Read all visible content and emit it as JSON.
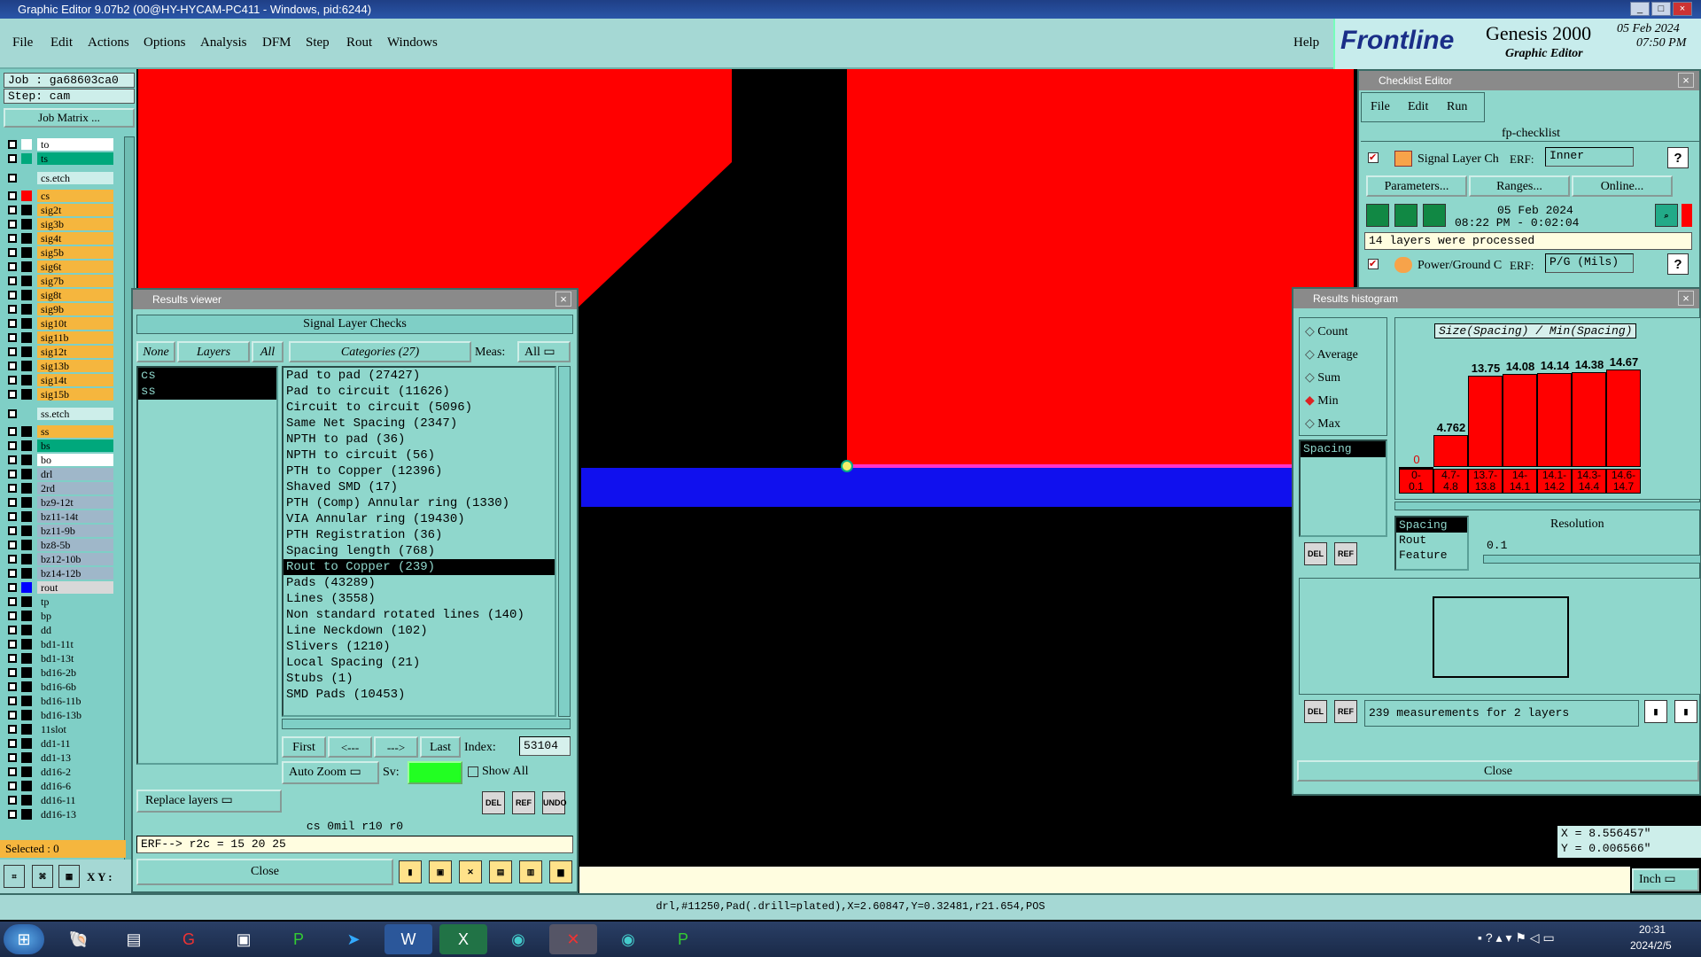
{
  "window": {
    "title": "Graphic Editor 9.07b2 (00@HY-HYCAM-PC411 - Windows, pid:6244)"
  },
  "menu": {
    "items": [
      "File",
      "Edit",
      "Actions",
      "Options",
      "Analysis",
      "DFM",
      "Step",
      "Rout",
      "Windows"
    ],
    "help": "Help"
  },
  "logo": {
    "brand": "Frontline",
    "product": "Genesis 2000",
    "subtitle": "Graphic Editor",
    "date": "05 Feb 2024",
    "time": "07:50 PM"
  },
  "job": {
    "job": "Job : ga68603ca0",
    "step": "Step: cam",
    "matrix_button": "Job Matrix ..."
  },
  "layers": [
    {
      "name": "to",
      "color": "#ffffff",
      "fill": "#ffffff"
    },
    {
      "name": "ts",
      "color": "#00a87c",
      "fill": "#00a87c"
    },
    {
      "name": "cs.etch",
      "color": "#7fcfc6",
      "fill": "#cdeeea",
      "header": true
    },
    {
      "name": "cs",
      "color": "#ff0000",
      "fill": "#f5b63e"
    },
    {
      "name": "sig2t",
      "color": "#000",
      "fill": "#f5b63e"
    },
    {
      "name": "sig3b",
      "color": "#000",
      "fill": "#f5b63e"
    },
    {
      "name": "sig4t",
      "color": "#000",
      "fill": "#f5b63e"
    },
    {
      "name": "sig5b",
      "color": "#000",
      "fill": "#f5b63e"
    },
    {
      "name": "sig6t",
      "color": "#000",
      "fill": "#f5b63e"
    },
    {
      "name": "sig7b",
      "color": "#000",
      "fill": "#f5b63e"
    },
    {
      "name": "sig8t",
      "color": "#000",
      "fill": "#f5b63e"
    },
    {
      "name": "sig9b",
      "color": "#000",
      "fill": "#f5b63e"
    },
    {
      "name": "sig10t",
      "color": "#000",
      "fill": "#f5b63e"
    },
    {
      "name": "sig11b",
      "color": "#000",
      "fill": "#f5b63e"
    },
    {
      "name": "sig12t",
      "color": "#000",
      "fill": "#f5b63e"
    },
    {
      "name": "sig13b",
      "color": "#000",
      "fill": "#f5b63e"
    },
    {
      "name": "sig14t",
      "color": "#000",
      "fill": "#f5b63e"
    },
    {
      "name": "sig15b",
      "color": "#000",
      "fill": "#f5b63e"
    },
    {
      "name": "ss.etch",
      "color": "#7fcfc6",
      "fill": "#cdeeea",
      "header": true
    },
    {
      "name": "ss",
      "color": "#000",
      "fill": "#f5b63e"
    },
    {
      "name": "bs",
      "color": "#000",
      "fill": "#00a87c"
    },
    {
      "name": "bo",
      "color": "#000",
      "fill": "#ffffff"
    },
    {
      "name": "drl",
      "color": "#000",
      "fill": "#9fb7c9"
    },
    {
      "name": "2rd",
      "color": "#000",
      "fill": "#9fb7c9"
    },
    {
      "name": "bz9-12t",
      "color": "#000",
      "fill": "#9fb7c9"
    },
    {
      "name": "bz11-14t",
      "color": "#000",
      "fill": "#9fb7c9"
    },
    {
      "name": "bz11-9b",
      "color": "#000",
      "fill": "#9fb7c9"
    },
    {
      "name": "bz8-5b",
      "color": "#000",
      "fill": "#9fb7c9"
    },
    {
      "name": "bz12-10b",
      "color": "#000",
      "fill": "#9fb7c9"
    },
    {
      "name": "bz14-12b",
      "color": "#000",
      "fill": "#9fb7c9"
    },
    {
      "name": "rout",
      "color": "#0000ff",
      "fill": "#d8d8d8"
    },
    {
      "name": "tp",
      "color": "#000",
      "fill": "#7fcfc6"
    },
    {
      "name": "bp",
      "color": "#000",
      "fill": "#7fcfc6"
    },
    {
      "name": "dd",
      "color": "#000",
      "fill": "#7fcfc6"
    },
    {
      "name": "bd1-11t",
      "color": "#000",
      "fill": "#7fcfc6"
    },
    {
      "name": "bd1-13t",
      "color": "#000",
      "fill": "#7fcfc6"
    },
    {
      "name": "bd16-2b",
      "color": "#000",
      "fill": "#7fcfc6"
    },
    {
      "name": "bd16-6b",
      "color": "#000",
      "fill": "#7fcfc6"
    },
    {
      "name": "bd16-11b",
      "color": "#000",
      "fill": "#7fcfc6"
    },
    {
      "name": "bd16-13b",
      "color": "#000",
      "fill": "#7fcfc6"
    },
    {
      "name": "11slot",
      "color": "#000",
      "fill": "#7fcfc6"
    },
    {
      "name": "dd1-11",
      "color": "#000",
      "fill": "#7fcfc6"
    },
    {
      "name": "dd1-13",
      "color": "#000",
      "fill": "#7fcfc6"
    },
    {
      "name": "dd16-2",
      "color": "#000",
      "fill": "#7fcfc6"
    },
    {
      "name": "dd16-6",
      "color": "#000",
      "fill": "#7fcfc6"
    },
    {
      "name": "dd16-11",
      "color": "#000",
      "fill": "#7fcfc6"
    },
    {
      "name": "dd16-13",
      "color": "#000",
      "fill": "#7fcfc6"
    }
  ],
  "selected": "Selected : 0",
  "xy_label": "X Y :",
  "results_viewer": {
    "title": "Results viewer",
    "header": "Signal Layer Checks",
    "none": "None",
    "layers": "Layers",
    "all": "All",
    "categories_btn": "Categories (27)",
    "meas": "Meas:",
    "meas_value": "All",
    "layer_list": [
      "cs",
      "ss"
    ],
    "categories": [
      "Pad to pad (27427)",
      "Pad to circuit (11626)",
      "Circuit to circuit (5096)",
      "Same Net Spacing (2347)",
      "NPTH to pad (36)",
      "NPTH to circuit (56)",
      "PTH to Copper (12396)",
      "Shaved SMD (17)",
      "PTH (Comp) Annular ring (1330)",
      "VIA Annular ring (19430)",
      "PTH Registration (36)",
      "Spacing length (768)",
      "Rout to Copper (239)",
      "Pads (43289)",
      "Lines (3558)",
      "Non standard rotated lines (140)",
      "Line Neckdown (102)",
      "Slivers (1210)",
      "Local Spacing (21)",
      "Stubs (1)",
      "SMD Pads (10453)"
    ],
    "selected_index": 12,
    "first": "First",
    "prev": "<---",
    "next": "--->",
    "last": "Last",
    "index_label": "Index:",
    "index_value": "53104",
    "auto_zoom": "Auto Zoom",
    "sv": "Sv:",
    "show_all": "Show All",
    "replace_layers": "Replace layers",
    "info_line": "cs 0mil   r10   r0",
    "erf_line": "ERF--> r2c = 15 20 25",
    "close": "Close"
  },
  "checklist": {
    "title": "Checklist Editor",
    "menu": [
      "File",
      "Edit",
      "Run"
    ],
    "name": "fp-checklist",
    "check1_name": "Signal Layer Ch",
    "erf_label": "ERF:",
    "check1_erf": "Inner",
    "params": "Parameters...",
    "ranges": "Ranges...",
    "online": "Online...",
    "date": "05 Feb 2024",
    "time": "08:22 PM - 0:02:04",
    "processed": "14 layers were processed",
    "check2_name": "Power/Ground C",
    "check2_erf": "P/G (Mils)"
  },
  "histogram": {
    "title": "Results histogram",
    "options": [
      "Count",
      "Average",
      "Sum",
      "Min",
      "Max"
    ],
    "selected_option": "Min",
    "measure": "Spacing",
    "chart_title": "Size(Spacing) / Min(Spacing)",
    "bars": [
      {
        "range": "0-0.1",
        "value": 0
      },
      {
        "range": "4.7-4.8",
        "value": 4.762
      },
      {
        "range": "13.7-13.8",
        "value": 13.75
      },
      {
        "range": "14-14.1",
        "value": 14.08
      },
      {
        "range": "14.1-14.2",
        "value": 14.14
      },
      {
        "range": "14.3-14.4",
        "value": 14.38
      },
      {
        "range": "14.6-14.7",
        "value": 14.67
      }
    ],
    "bar_labels": [
      "0",
      "4.762",
      "13.75",
      "14.08",
      "14.14",
      "14.38",
      "14.67"
    ],
    "range_labels": [
      "0-\n0.1",
      "4.7-\n4.8",
      "13.7-\n13.8",
      "14-\n14.1",
      "14.1-\n14.2",
      "14.3-\n14.4",
      "14.6-\n14.7"
    ],
    "list": [
      "Spacing",
      "Rout",
      "Feature"
    ],
    "resolution_label": "Resolution",
    "resolution": "0.1",
    "measurements": "239 measurements for 2 layers",
    "close": "Close"
  },
  "coords": {
    "x": "X = 8.556457\"",
    "y": "Y = 0.006566\"",
    "unit": "Inch"
  },
  "status": "drl,#11250,Pad(.drill=plated),X=2.60847,Y=0.32481,r21.654,POS",
  "tray": {
    "time": "20:31",
    "date": "2024/2/5"
  },
  "icons": {
    "del": "DEL",
    "ref": "REF",
    "undo": "UNDO"
  }
}
